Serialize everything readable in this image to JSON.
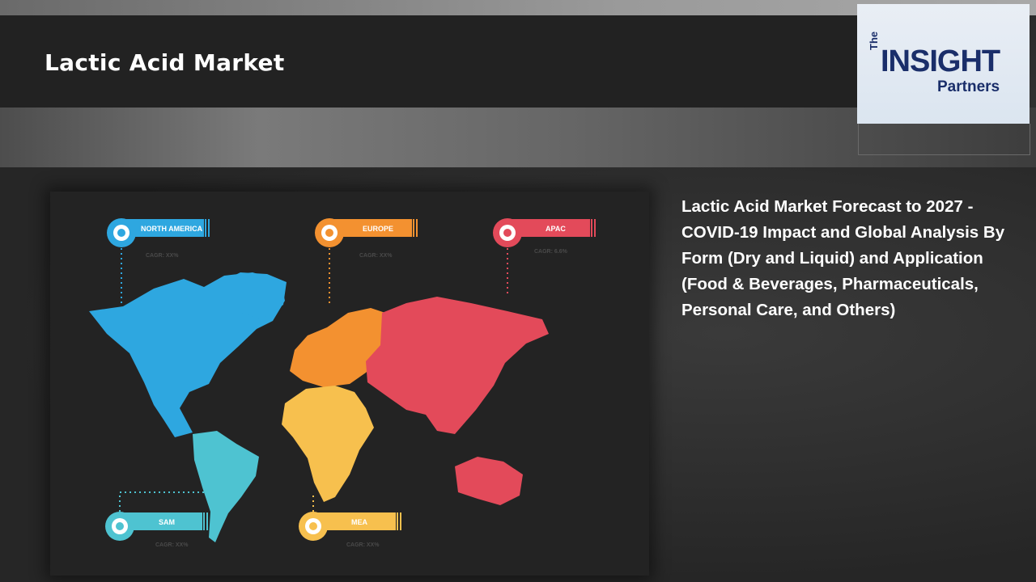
{
  "header": {
    "title": "Lactic Acid Market"
  },
  "logo": {
    "the": "The",
    "insight": "INSIGHT",
    "partners": "Partners"
  },
  "report": {
    "title": "Lactic Acid Market Forecast to 2027 - COVID-19 Impact and Global Analysis By Form (Dry and Liquid) and Application (Food & Beverages, Pharmaceuticals, Personal Care, and Others)"
  },
  "regions": [
    {
      "key": "north_america",
      "name": "NORTH AMERICA",
      "cagr": "CAGR: XX%",
      "color": "#2ea7e0"
    },
    {
      "key": "europe",
      "name": "EUROPE",
      "cagr": "CAGR: XX%",
      "color": "#f39130"
    },
    {
      "key": "apac",
      "name": "APAC",
      "cagr": "CAGR: 6.6%",
      "color": "#e34a5a"
    },
    {
      "key": "sam",
      "name": "SAM",
      "cagr": "CAGR: XX%",
      "color": "#4ec3d1"
    },
    {
      "key": "mea",
      "name": "MEA",
      "cagr": "CAGR: XX%",
      "color": "#f7c04e"
    }
  ]
}
